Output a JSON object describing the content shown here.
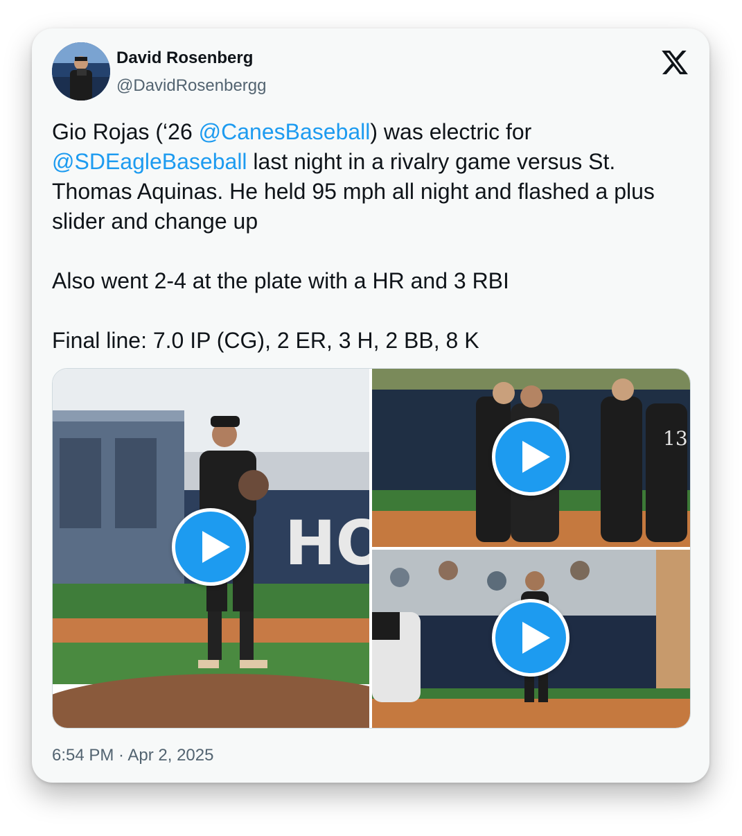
{
  "author": {
    "name": "David Rosenberg",
    "handle": "@DavidRosenbergg",
    "avatar_icon": "profile-photo"
  },
  "platform_icon": "x-logo-icon",
  "tweet": {
    "line1_pre": "Gio Rojas (‘26 ",
    "mention1": "@CanesBaseball",
    "line1_post": ") was electric for",
    "mention2": "@SDEagleBaseball",
    "line2_post": " last night in a rivalry game versus St. Thomas Aquinas. He held 95 mph all night and flashed a plus slider and change up",
    "para2": "Also went 2-4 at the plate with a HR and 3 RBI",
    "para3": "Final line: 7.0 IP (CG), 2 ER, 3 H, 2 BB, 8 K"
  },
  "media": [
    {
      "kind": "video",
      "icon": "play-icon"
    },
    {
      "kind": "video",
      "icon": "play-icon"
    },
    {
      "kind": "video",
      "icon": "play-icon"
    }
  ],
  "footer": {
    "timestamp": "6:54 PM · Apr 2, 2025"
  },
  "colors": {
    "link": "#1d9bf0",
    "text": "#0f1419",
    "muted": "#536471",
    "play_button": "#1d9bf0"
  }
}
